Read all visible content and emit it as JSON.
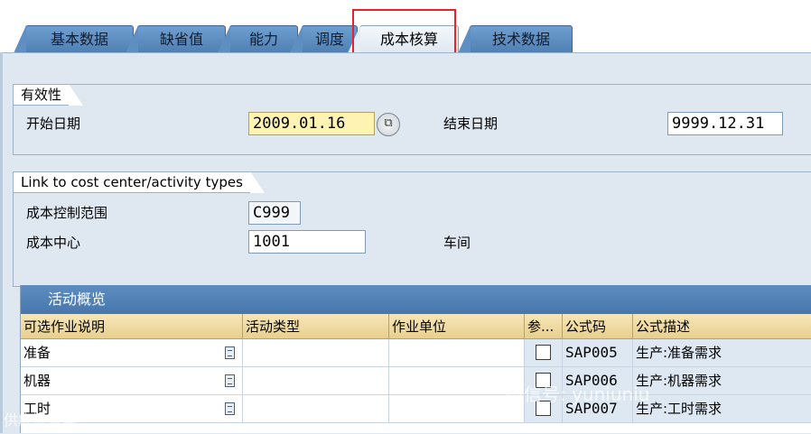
{
  "tabs": [
    {
      "label": "基本数据",
      "active": false
    },
    {
      "label": "缺省值",
      "active": false
    },
    {
      "label": "能力",
      "active": false
    },
    {
      "label": "调度",
      "active": false
    },
    {
      "label": "成本核算",
      "active": true
    },
    {
      "label": "技术数据",
      "active": false
    }
  ],
  "validity": {
    "title": "有效性",
    "start_label": "开始日期",
    "start_value": "2009.01.16",
    "end_label": "结束日期",
    "end_value": "9999.12.31"
  },
  "cost_link": {
    "title": "Link to cost center/activity types",
    "area_label": "成本控制范围",
    "area_value": "C999",
    "center_label": "成本中心",
    "center_value": "1001",
    "center_desc": "车间"
  },
  "activity": {
    "title": "活动概览",
    "columns": [
      "可选作业说明",
      "活动类型",
      "作业单位",
      "参...",
      "公式码",
      "公式描述"
    ],
    "rows": [
      {
        "desc": "准备",
        "type": "",
        "unit": "",
        "ref": false,
        "formula": "SAP005",
        "formula_desc": "生产:准备需求"
      },
      {
        "desc": "机器",
        "type": "",
        "unit": "",
        "ref": false,
        "formula": "SAP006",
        "formula_desc": "生产:机器需求"
      },
      {
        "desc": "工时",
        "type": "",
        "unit": "",
        "ref": false,
        "formula": "SAP007",
        "formula_desc": "生产:工时需求"
      }
    ]
  },
  "watermarks": {
    "center": "微信号: yuniuniu",
    "bottom_left": "供应链管理"
  },
  "colors": {
    "tab": "#5a8bc0",
    "highlight": "#e5242a",
    "required": "#fff3b3",
    "grid_header": "#ecd598"
  }
}
